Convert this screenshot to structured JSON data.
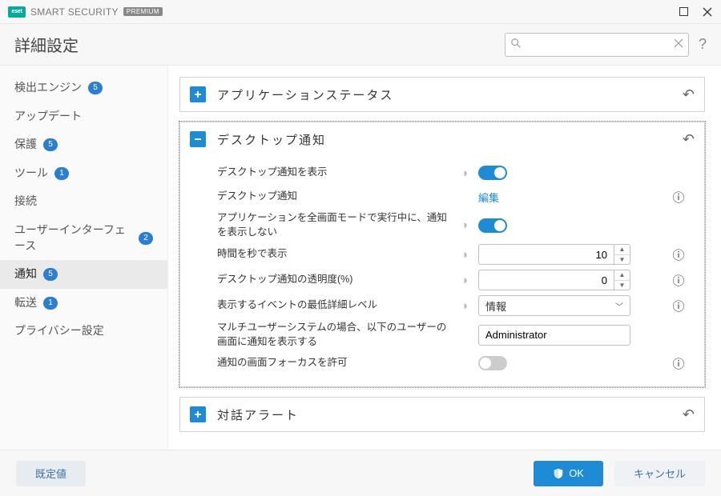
{
  "titlebar": {
    "brand_code": "eset",
    "product": "SMART SECURITY",
    "edition": "PREMIUM"
  },
  "header": {
    "title": "詳細設定",
    "search_placeholder": ""
  },
  "sidebar": {
    "items": [
      {
        "label": "検出エンジン",
        "badge": "5",
        "active": false
      },
      {
        "label": "アップデート",
        "badge": null,
        "active": false
      },
      {
        "label": "保護",
        "badge": "5",
        "active": false
      },
      {
        "label": "ツール",
        "badge": "1",
        "active": false
      },
      {
        "label": "接続",
        "badge": null,
        "active": false
      },
      {
        "label": "ユーザーインターフェース",
        "badge": "2",
        "active": false
      },
      {
        "label": "通知",
        "badge": "5",
        "active": true
      },
      {
        "label": "転送",
        "badge": "1",
        "active": false
      },
      {
        "label": "プライバシー設定",
        "badge": null,
        "active": false
      }
    ]
  },
  "sections": {
    "app_status": {
      "title": "アプリケーションステータス",
      "expanded": false
    },
    "desktop_notif": {
      "title": "デスクトップ通知",
      "expanded": true,
      "rows": {
        "show_notif": {
          "label": "デスクトップ通知を表示",
          "toggle": true
        },
        "notif_edit": {
          "label": "デスクトップ通知",
          "link": "編集"
        },
        "fullscreen": {
          "label": "アプリケーションを全画面モードで実行中に、通知を表示しない",
          "toggle": true
        },
        "seconds": {
          "label": "時間を秒で表示",
          "value": "10"
        },
        "opacity": {
          "label": "デスクトップ通知の透明度(%)",
          "value": "0"
        },
        "verbosity": {
          "label": "表示するイベントの最低詳細レベル",
          "value": "情報"
        },
        "multiuser": {
          "label": "マルチユーザーシステムの場合、以下のユーザーの画面に通知を表示する",
          "value": "Administrator"
        },
        "focus": {
          "label": "通知の画面フォーカスを許可",
          "toggle": false
        }
      }
    },
    "dialog_alert": {
      "title": "対話アラート",
      "expanded": false
    }
  },
  "footer": {
    "default": "既定値",
    "ok": "OK",
    "cancel": "キャンセル"
  }
}
